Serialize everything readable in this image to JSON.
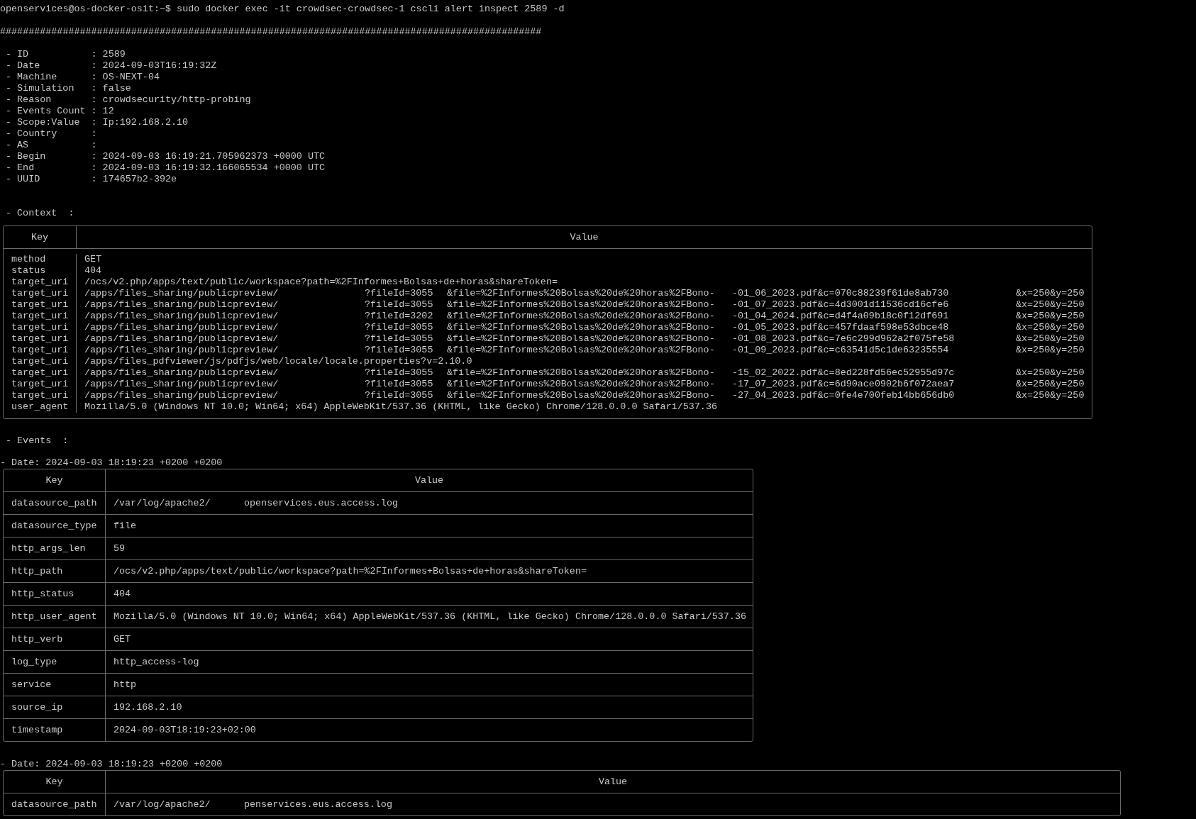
{
  "command": "openservices@os-docker-osit:~$ sudo docker exec -it crowdsec-crowdsec-1 cscli alert inspect 2589 -d",
  "separator": "###############################################################################################",
  "fields": [
    "- ID           : 2589",
    "- Date         : 2024-09-03T16:19:32Z",
    "- Machine      : OS-NEXT-04",
    "- Simulation   : false",
    "- Reason       : crowdsecurity/http-probing",
    "- Events Count : 12",
    "- Scope:Value  : Ip:192.168.2.10",
    "- Country      :",
    "- AS           :",
    "- Begin        : 2024-09-03 16:19:21.705962373 +0000 UTC",
    "- End          : 2024-09-03 16:19:32.166065534 +0000 UTC",
    "- UUID         : 174657b2-392e"
  ],
  "context": {
    "heading": "- Context  :",
    "columns": [
      "Key",
      "Value"
    ],
    "rows": [
      {
        "key": "method",
        "value": [
          "GET"
        ]
      },
      {
        "key": "status",
        "value": [
          "404"
        ]
      },
      {
        "key": "target_uri",
        "value": [
          "/ocs/v2.php/apps/text/public/workspace?path=%2FInformes+Bolsas+de+horas&shareToken="
        ]
      },
      {
        "key": "target_uri",
        "value": [
          "/apps/files_sharing/publicpreview/",
          "?fileId=3055",
          "&file=%2FInformes%20Bolsas%20de%20horas%2FBono-",
          "-01_06_2023.pdf&c=070c88239f61de8ab730",
          "&x=250&y=250"
        ]
      },
      {
        "key": "target_uri",
        "value": [
          "/apps/files_sharing/publicpreview/",
          "?fileId=3055",
          "&file=%2FInformes%20Bolsas%20de%20horas%2FBono-",
          "-01_07_2023.pdf&c=4d3001d11536cd16cfe6",
          "&x=250&y=250"
        ]
      },
      {
        "key": "target_uri",
        "value": [
          "/apps/files_sharing/publicpreview/",
          "?fileId=3202",
          "&file=%2FInformes%20Bolsas%20de%20horas%2FBono-",
          "-01_04_2024.pdf&c=d4f4a09b18c0f12df691",
          "&x=250&y=250"
        ]
      },
      {
        "key": "target_uri",
        "value": [
          "/apps/files_sharing/publicpreview/",
          "?fileId=3055",
          "&file=%2FInformes%20Bolsas%20de%20horas%2FBono-",
          "-01_05_2023.pdf&c=457fdaaf598e53dbce48",
          "&x=250&y=250"
        ]
      },
      {
        "key": "target_uri",
        "value": [
          "/apps/files_sharing/publicpreview/",
          "?fileId=3055",
          "&file=%2FInformes%20Bolsas%20de%20horas%2FBono-",
          "-01_08_2023.pdf&c=7e6c299d962a2f075fe58",
          "&x=250&y=250"
        ]
      },
      {
        "key": "target_uri",
        "value": [
          "/apps/files_sharing/publicpreview/",
          "?fileId=3055",
          "&file=%2FInformes%20Bolsas%20de%20horas%2FBono-",
          "-01_09_2023.pdf&c=c63541d5c1de63235554",
          "&x=250&y=250"
        ]
      },
      {
        "key": "target_uri",
        "value": [
          "/apps/files_pdfviewer/js/pdfjs/web/locale/locale.properties?v=2.10.0"
        ]
      },
      {
        "key": "target_uri",
        "value": [
          "/apps/files_sharing/publicpreview/",
          "?fileId=3055",
          "&file=%2FInformes%20Bolsas%20de%20horas%2FBono-",
          "-15_02_2022.pdf&c=8ed228fd56ec52955d97c",
          "&x=250&y=250"
        ]
      },
      {
        "key": "target_uri",
        "value": [
          "/apps/files_sharing/publicpreview/",
          "?fileId=3055",
          "&file=%2FInformes%20Bolsas%20de%20horas%2FBono-",
          "-17_07_2023.pdf&c=6d90ace0902b6f072aea7",
          "&x=250&y=250"
        ]
      },
      {
        "key": "target_uri",
        "value": [
          "/apps/files_sharing/publicpreview/",
          "?fileId=3055",
          "&file=%2FInformes%20Bolsas%20de%20horas%2FBono-",
          "-27_04_2023.pdf&c=0fe4e700feb14bb656db0",
          "&x=250&y=250"
        ]
      },
      {
        "key": "user_agent",
        "value": [
          "Mozilla/5.0 (Windows NT 10.0; Win64; x64) AppleWebKit/537.36 (KHTML, like Gecko) Chrome/128.0.0.0 Safari/537.36"
        ]
      }
    ]
  },
  "events": {
    "heading": "- Events  :",
    "items": [
      {
        "date": "- Date: 2024-09-03 18:19:23 +0200 +0200",
        "columns": [
          "Key",
          "Value"
        ],
        "rows": [
          {
            "key": "datasource_path",
            "value": [
              "/var/log/apache2/",
              "openservices.eus.access.log"
            ]
          },
          {
            "key": "datasource_type",
            "value": [
              "file"
            ]
          },
          {
            "key": "http_args_len",
            "value": [
              "59"
            ]
          },
          {
            "key": "http_path",
            "value": [
              "/ocs/v2.php/apps/text/public/workspace?path=%2FInformes+Bolsas+de+horas&shareToken="
            ]
          },
          {
            "key": "http_status",
            "value": [
              "404"
            ]
          },
          {
            "key": "http_user_agent",
            "value": [
              "Mozilla/5.0 (Windows NT 10.0; Win64; x64) AppleWebKit/537.36 (KHTML, like Gecko) Chrome/128.0.0.0 Safari/537.36"
            ]
          },
          {
            "key": "http_verb",
            "value": [
              "GET"
            ]
          },
          {
            "key": "log_type",
            "value": [
              "http_access-log"
            ]
          },
          {
            "key": "service",
            "value": [
              "http"
            ]
          },
          {
            "key": "source_ip",
            "value": [
              "192.168.2.10"
            ]
          },
          {
            "key": "timestamp",
            "value": [
              "2024-09-03T18:19:23+02:00"
            ]
          }
        ]
      },
      {
        "date": "- Date: 2024-09-03 18:19:23 +0200 +0200",
        "columns": [
          "Key",
          "Value"
        ],
        "rows": [
          {
            "key": "datasource_path",
            "value": [
              "/var/log/apache2/",
              "penservices.eus.access.log"
            ]
          }
        ]
      }
    ]
  }
}
